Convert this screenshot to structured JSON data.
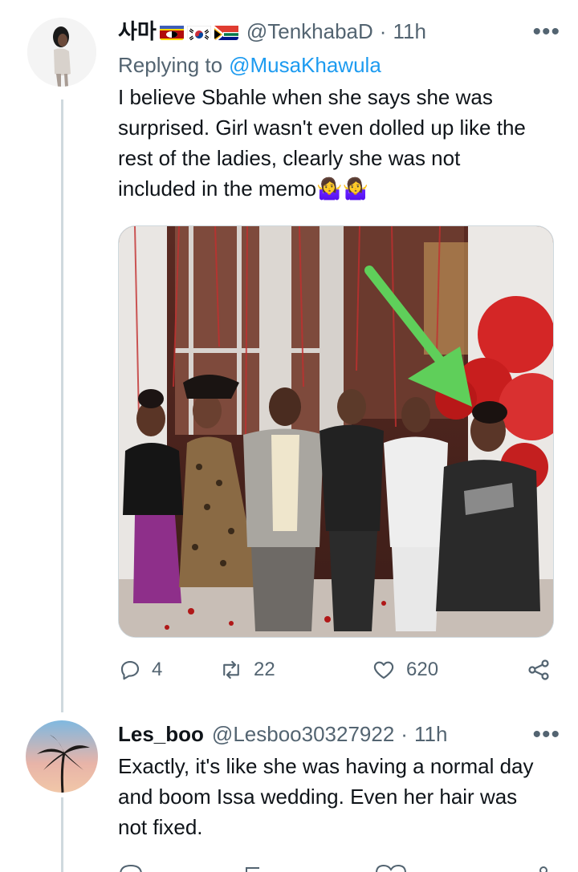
{
  "tweet1": {
    "display_name": "사마",
    "handle": "@TenkhabaD",
    "separator": "·",
    "time": "11h",
    "replying_prefix": "Replying to",
    "replying_handle": "@MusaKhawula",
    "text": "I believe Sbahle when she says she was surprised. Girl wasn't even dolled up like the rest of the ladies, clearly she was not included in the memo",
    "emoji": "🤷‍♀️🤷‍♀️",
    "more": "•••",
    "replies": "4",
    "retweets": "22",
    "likes": "620"
  },
  "tweet2": {
    "display_name": "Les_boo",
    "handle": "@Lesboo30327922",
    "separator": "·",
    "time": "11h",
    "text": "Exactly, it's like she was having a normal day and boom Issa wedding. Even her hair was not fixed.",
    "more": "•••"
  },
  "colors": {
    "accent": "#1d9bf0",
    "muted": "#536471",
    "line": "#cfd9de",
    "arrow": "#5fcf5a"
  },
  "icons": {
    "reply": "reply-icon",
    "retweet": "retweet-icon",
    "like": "heart-icon",
    "share": "share-icon"
  }
}
